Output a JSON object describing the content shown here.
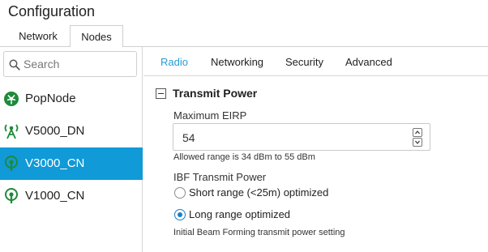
{
  "app": {
    "title": "Configuration"
  },
  "top_tabs": [
    {
      "label": "Network",
      "active": false
    },
    {
      "label": "Nodes",
      "active": true
    }
  ],
  "search": {
    "placeholder": "Search",
    "icon": "search-icon"
  },
  "nodes": [
    {
      "label": "PopNode",
      "icon": "pop-node-icon",
      "selected": false
    },
    {
      "label": "V5000_DN",
      "icon": "dn-antenna-icon",
      "selected": false
    },
    {
      "label": "V3000_CN",
      "icon": "cn-antenna-icon",
      "selected": true
    },
    {
      "label": "V1000_CN",
      "icon": "cn-antenna-icon",
      "selected": false
    }
  ],
  "panel_tabs": [
    {
      "label": "Radio",
      "active": true
    },
    {
      "label": "Networking",
      "active": false
    },
    {
      "label": "Security",
      "active": false
    },
    {
      "label": "Advanced",
      "active": false
    }
  ],
  "section": {
    "title": "Transmit Power",
    "max_eirp": {
      "label": "Maximum EIRP",
      "value": "54",
      "help": "Allowed range is 34 dBm to 55 dBm"
    },
    "ibf": {
      "label": "IBF Transmit Power",
      "options": [
        {
          "label": "Short range (<25m) optimized",
          "checked": false
        },
        {
          "label": "Long range optimized",
          "checked": true
        }
      ],
      "help": "Initial Beam Forming transmit power setting"
    }
  },
  "colors": {
    "selection": "#109ad7",
    "active_tab": "#2a9ad6",
    "node_icon": "#1f8a3a"
  }
}
